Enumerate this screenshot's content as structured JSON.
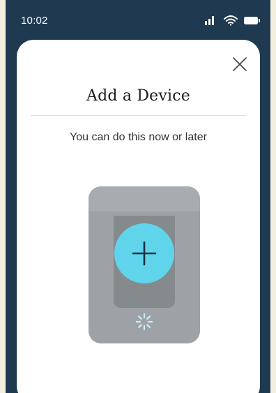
{
  "status_bar": {
    "time": "10:02",
    "icons": [
      "signal-icon",
      "wifi-icon",
      "battery-icon"
    ]
  },
  "modal": {
    "title": "Add a Device",
    "subtitle": "You can do this now or later",
    "close_icon": "close-icon",
    "add_icon": "plus-icon"
  },
  "colors": {
    "background": "#1f3950",
    "sheet": "#ffffff",
    "accent": "#5fd4ea",
    "device": "#9ea2a6"
  }
}
